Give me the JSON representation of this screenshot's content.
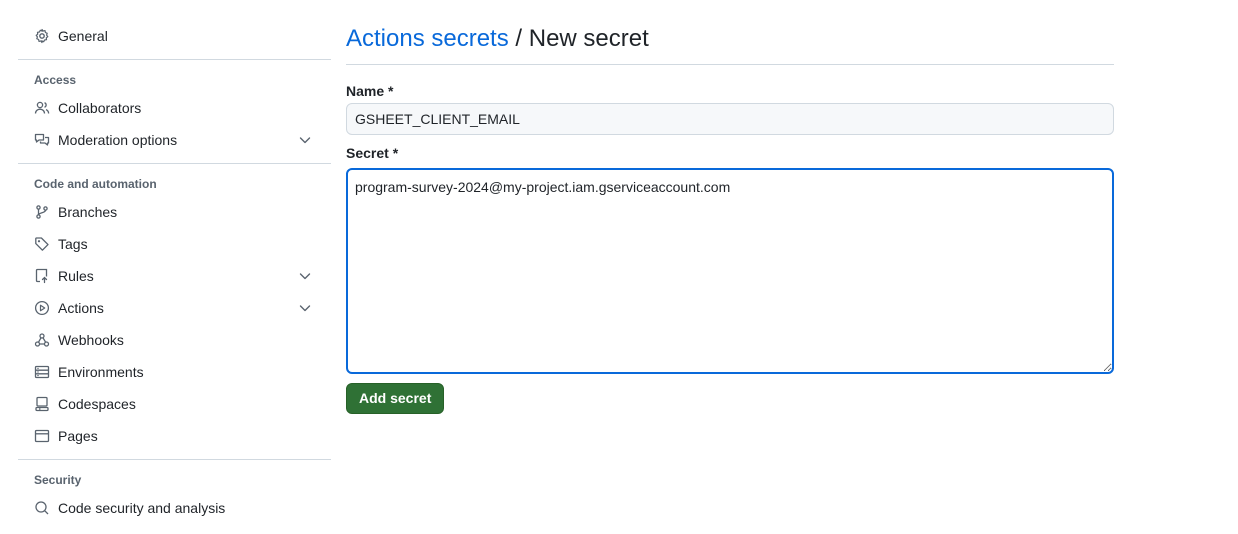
{
  "sidebar": {
    "general": "General",
    "sections": [
      {
        "title": "Access",
        "items": [
          {
            "label": "Collaborators",
            "icon": "people-icon"
          },
          {
            "label": "Moderation options",
            "icon": "comment-discussion-icon",
            "expandable": true
          }
        ]
      },
      {
        "title": "Code and automation",
        "items": [
          {
            "label": "Branches",
            "icon": "git-branch-icon"
          },
          {
            "label": "Tags",
            "icon": "tag-icon"
          },
          {
            "label": "Rules",
            "icon": "repo-push-icon",
            "expandable": true
          },
          {
            "label": "Actions",
            "icon": "play-icon",
            "expandable": true
          },
          {
            "label": "Webhooks",
            "icon": "webhook-icon"
          },
          {
            "label": "Environments",
            "icon": "server-icon"
          },
          {
            "label": "Codespaces",
            "icon": "codespaces-icon"
          },
          {
            "label": "Pages",
            "icon": "browser-icon"
          }
        ]
      },
      {
        "title": "Security",
        "items": [
          {
            "label": "Code security and analysis",
            "icon": "codescan-icon"
          }
        ]
      }
    ]
  },
  "main": {
    "breadcrumb_link": "Actions secrets",
    "breadcrumb_sep": " / ",
    "breadcrumb_current": "New secret",
    "name_label": "Name *",
    "name_value": "GSHEET_CLIENT_EMAIL",
    "secret_label": "Secret *",
    "secret_value": "program-survey-2024@my-project.iam.gserviceaccount.com",
    "submit_label": "Add secret"
  },
  "colors": {
    "link": "#0969da",
    "primary_button": "#2f7135",
    "focus_border": "#0969da"
  }
}
